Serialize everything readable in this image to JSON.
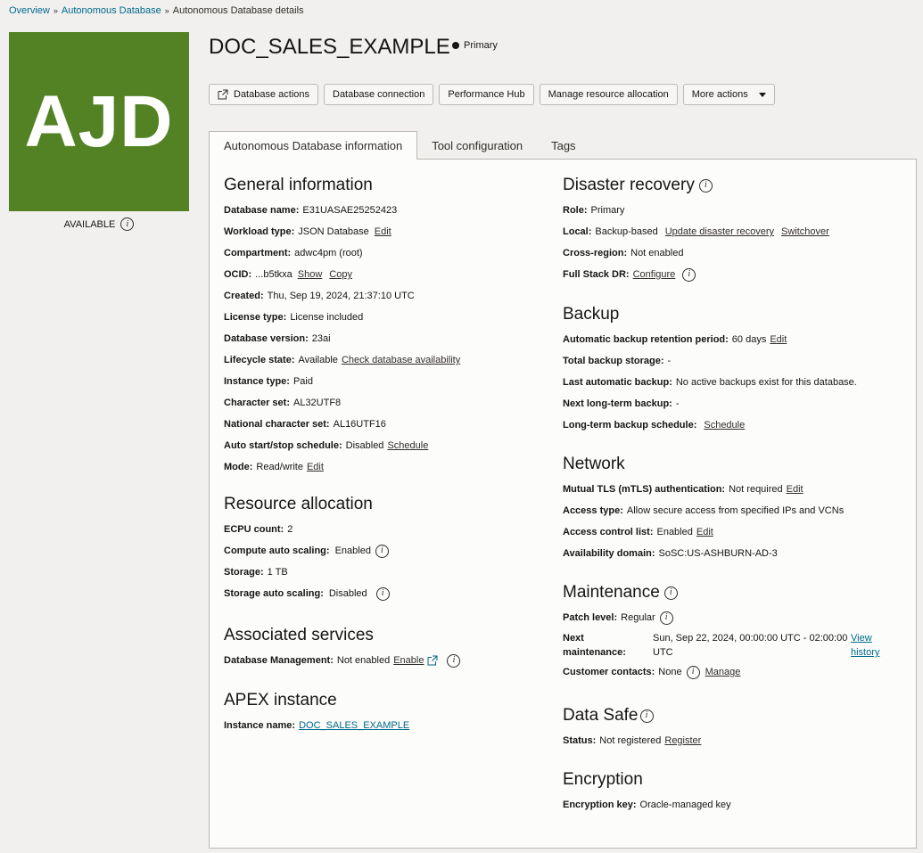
{
  "breadcrumb": {
    "items": [
      "Overview",
      "Autonomous Database",
      "Autonomous Database details"
    ]
  },
  "logo": {
    "text": "AJD",
    "color": "#538224"
  },
  "lifecycle_status": "AVAILABLE",
  "header": {
    "title": "DOC_SALES_EXAMPLE",
    "role": "Primary"
  },
  "actions": {
    "database_actions": "Database actions",
    "database_connection": "Database connection",
    "performance_hub": "Performance Hub",
    "manage_resource_allocation": "Manage resource allocation",
    "more_actions": "More actions"
  },
  "tabs": [
    {
      "label": "Autonomous Database information",
      "active": true
    },
    {
      "label": "Tool configuration",
      "active": false
    },
    {
      "label": "Tags",
      "active": false
    }
  ],
  "general": {
    "heading": "General information",
    "database_name": {
      "label": "Database name:",
      "value": "E31UASAE25252423"
    },
    "workload_type": {
      "label": "Workload type:",
      "value": "JSON Database",
      "link": "Edit"
    },
    "compartment": {
      "label": "Compartment:",
      "value": "adwc4pm (root)"
    },
    "ocid": {
      "label": "OCID:",
      "value": "...b5tkxa",
      "show": "Show",
      "copy": "Copy"
    },
    "created": {
      "label": "Created:",
      "value": "Thu, Sep 19, 2024, 21:37:10 UTC"
    },
    "license_type": {
      "label": "License type:",
      "value": "License included"
    },
    "database_version": {
      "label": "Database version:",
      "value": "23ai"
    },
    "lifecycle_state": {
      "label": "Lifecycle state:",
      "value": "Available",
      "link": "Check database availability"
    },
    "instance_type": {
      "label": "Instance type:",
      "value": "Paid"
    },
    "character_set": {
      "label": "Character set:",
      "value": "AL32UTF8"
    },
    "national_character_set": {
      "label": "National character set:",
      "value": "AL16UTF16"
    },
    "auto_start_stop": {
      "label": "Auto start/stop schedule:",
      "value": "Disabled",
      "link": "Schedule"
    },
    "mode": {
      "label": "Mode:",
      "value": "Read/write",
      "link": "Edit"
    }
  },
  "resource_allocation": {
    "heading": "Resource allocation",
    "ecpu_count": {
      "label": "ECPU count:",
      "value": "2"
    },
    "compute_auto_scaling": {
      "label": "Compute auto scaling:",
      "value": "Enabled"
    },
    "storage": {
      "label": "Storage:",
      "value": "1 TB"
    },
    "storage_auto_scaling": {
      "label": "Storage auto scaling:",
      "value": "Disabled"
    }
  },
  "associated_services": {
    "heading": "Associated services",
    "database_management": {
      "label": "Database Management:",
      "value": "Not enabled",
      "link": "Enable"
    }
  },
  "apex": {
    "heading": "APEX instance",
    "instance_name": {
      "label": "Instance name:",
      "value": "DOC_SALES_EXAMPLE"
    }
  },
  "disaster_recovery": {
    "heading": "Disaster recovery",
    "role": {
      "label": "Role:",
      "value": "Primary"
    },
    "local": {
      "label": "Local:",
      "value": "Backup-based",
      "link_update": "Update disaster recovery",
      "link_switchover": "Switchover"
    },
    "cross_region": {
      "label": "Cross-region:",
      "value": "Not enabled"
    },
    "full_stack_dr": {
      "label": "Full Stack DR:",
      "link": "Configure"
    }
  },
  "backup": {
    "heading": "Backup",
    "retention": {
      "label": "Automatic backup retention period:",
      "value": "60 days",
      "link": "Edit"
    },
    "total_storage": {
      "label": "Total backup storage:",
      "value": "-"
    },
    "last_automatic": {
      "label": "Last automatic backup:",
      "value": "No active backups exist for this database."
    },
    "next_long_term": {
      "label": "Next long-term backup:",
      "value": "-"
    },
    "long_term_schedule": {
      "label": "Long-term backup schedule:",
      "link": "Schedule"
    }
  },
  "network": {
    "heading": "Network",
    "mtls": {
      "label": "Mutual TLS (mTLS) authentication:",
      "value": "Not required",
      "link": "Edit"
    },
    "access_type": {
      "label": "Access type:",
      "value": "Allow secure access from specified IPs and VCNs"
    },
    "acl": {
      "label": "Access control list:",
      "value": "Enabled",
      "link": "Edit"
    },
    "availability_domain": {
      "label": "Availability domain:",
      "value": "SoSC:US-ASHBURN-AD-3"
    }
  },
  "maintenance": {
    "heading": "Maintenance",
    "patch_level": {
      "label": "Patch level:",
      "value": "Regular"
    },
    "next_maintenance": {
      "label_line1": "Next",
      "label_line2": "maintenance:",
      "value_line1": "Sun, Sep 22, 2024, 00:00:00 UTC - 02:00:00",
      "value_line2": "UTC",
      "link_line1": "View",
      "link_line2": "history"
    },
    "customer_contacts": {
      "label": "Customer contacts:",
      "value": "None",
      "link": "Manage"
    }
  },
  "data_safe": {
    "heading": "Data Safe",
    "status": {
      "label": "Status:",
      "value": "Not registered",
      "link": "Register"
    }
  },
  "encryption": {
    "heading": "Encryption",
    "key": {
      "label": "Encryption key:",
      "value": "Oracle-managed key"
    }
  }
}
